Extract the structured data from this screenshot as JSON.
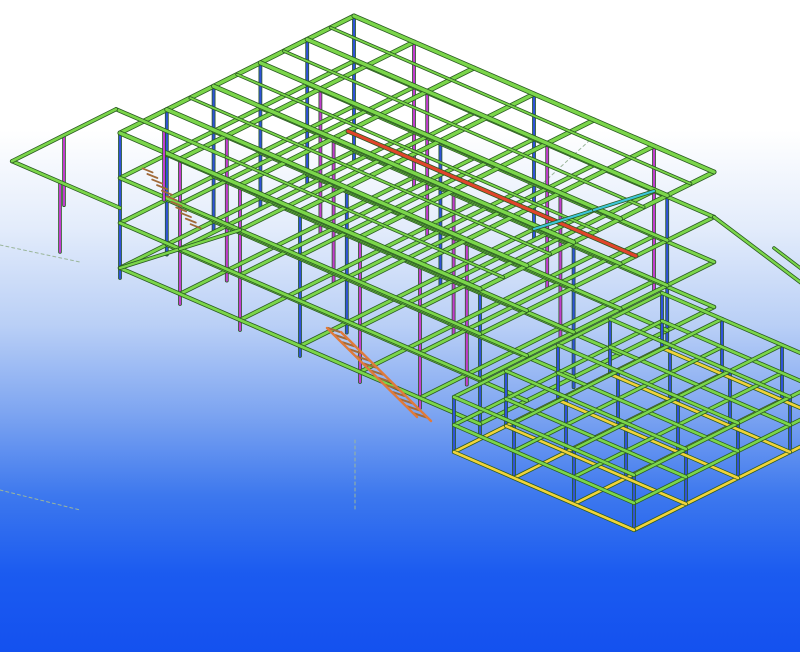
{
  "viewport": {
    "view_type": "3d-steel-structure-model",
    "background_top": "#ffffff",
    "background_bottom": "#1451ef"
  },
  "colors": {
    "beam_primary": "#7bd64a",
    "beam_dark": "#3d9a2a",
    "column_magenta": "#c23ccf",
    "column_blue": "#2f52d8",
    "beam_red": "#e0452b",
    "beam_yellow": "#f0d33a",
    "stair_brown": "#a06a3a",
    "stair_orange": "#e07a3a",
    "brace_cyan": "#3cc6d8",
    "guide_line": "#9bb69b"
  },
  "icons": {
    "model": "steel-frame-model-icon"
  }
}
